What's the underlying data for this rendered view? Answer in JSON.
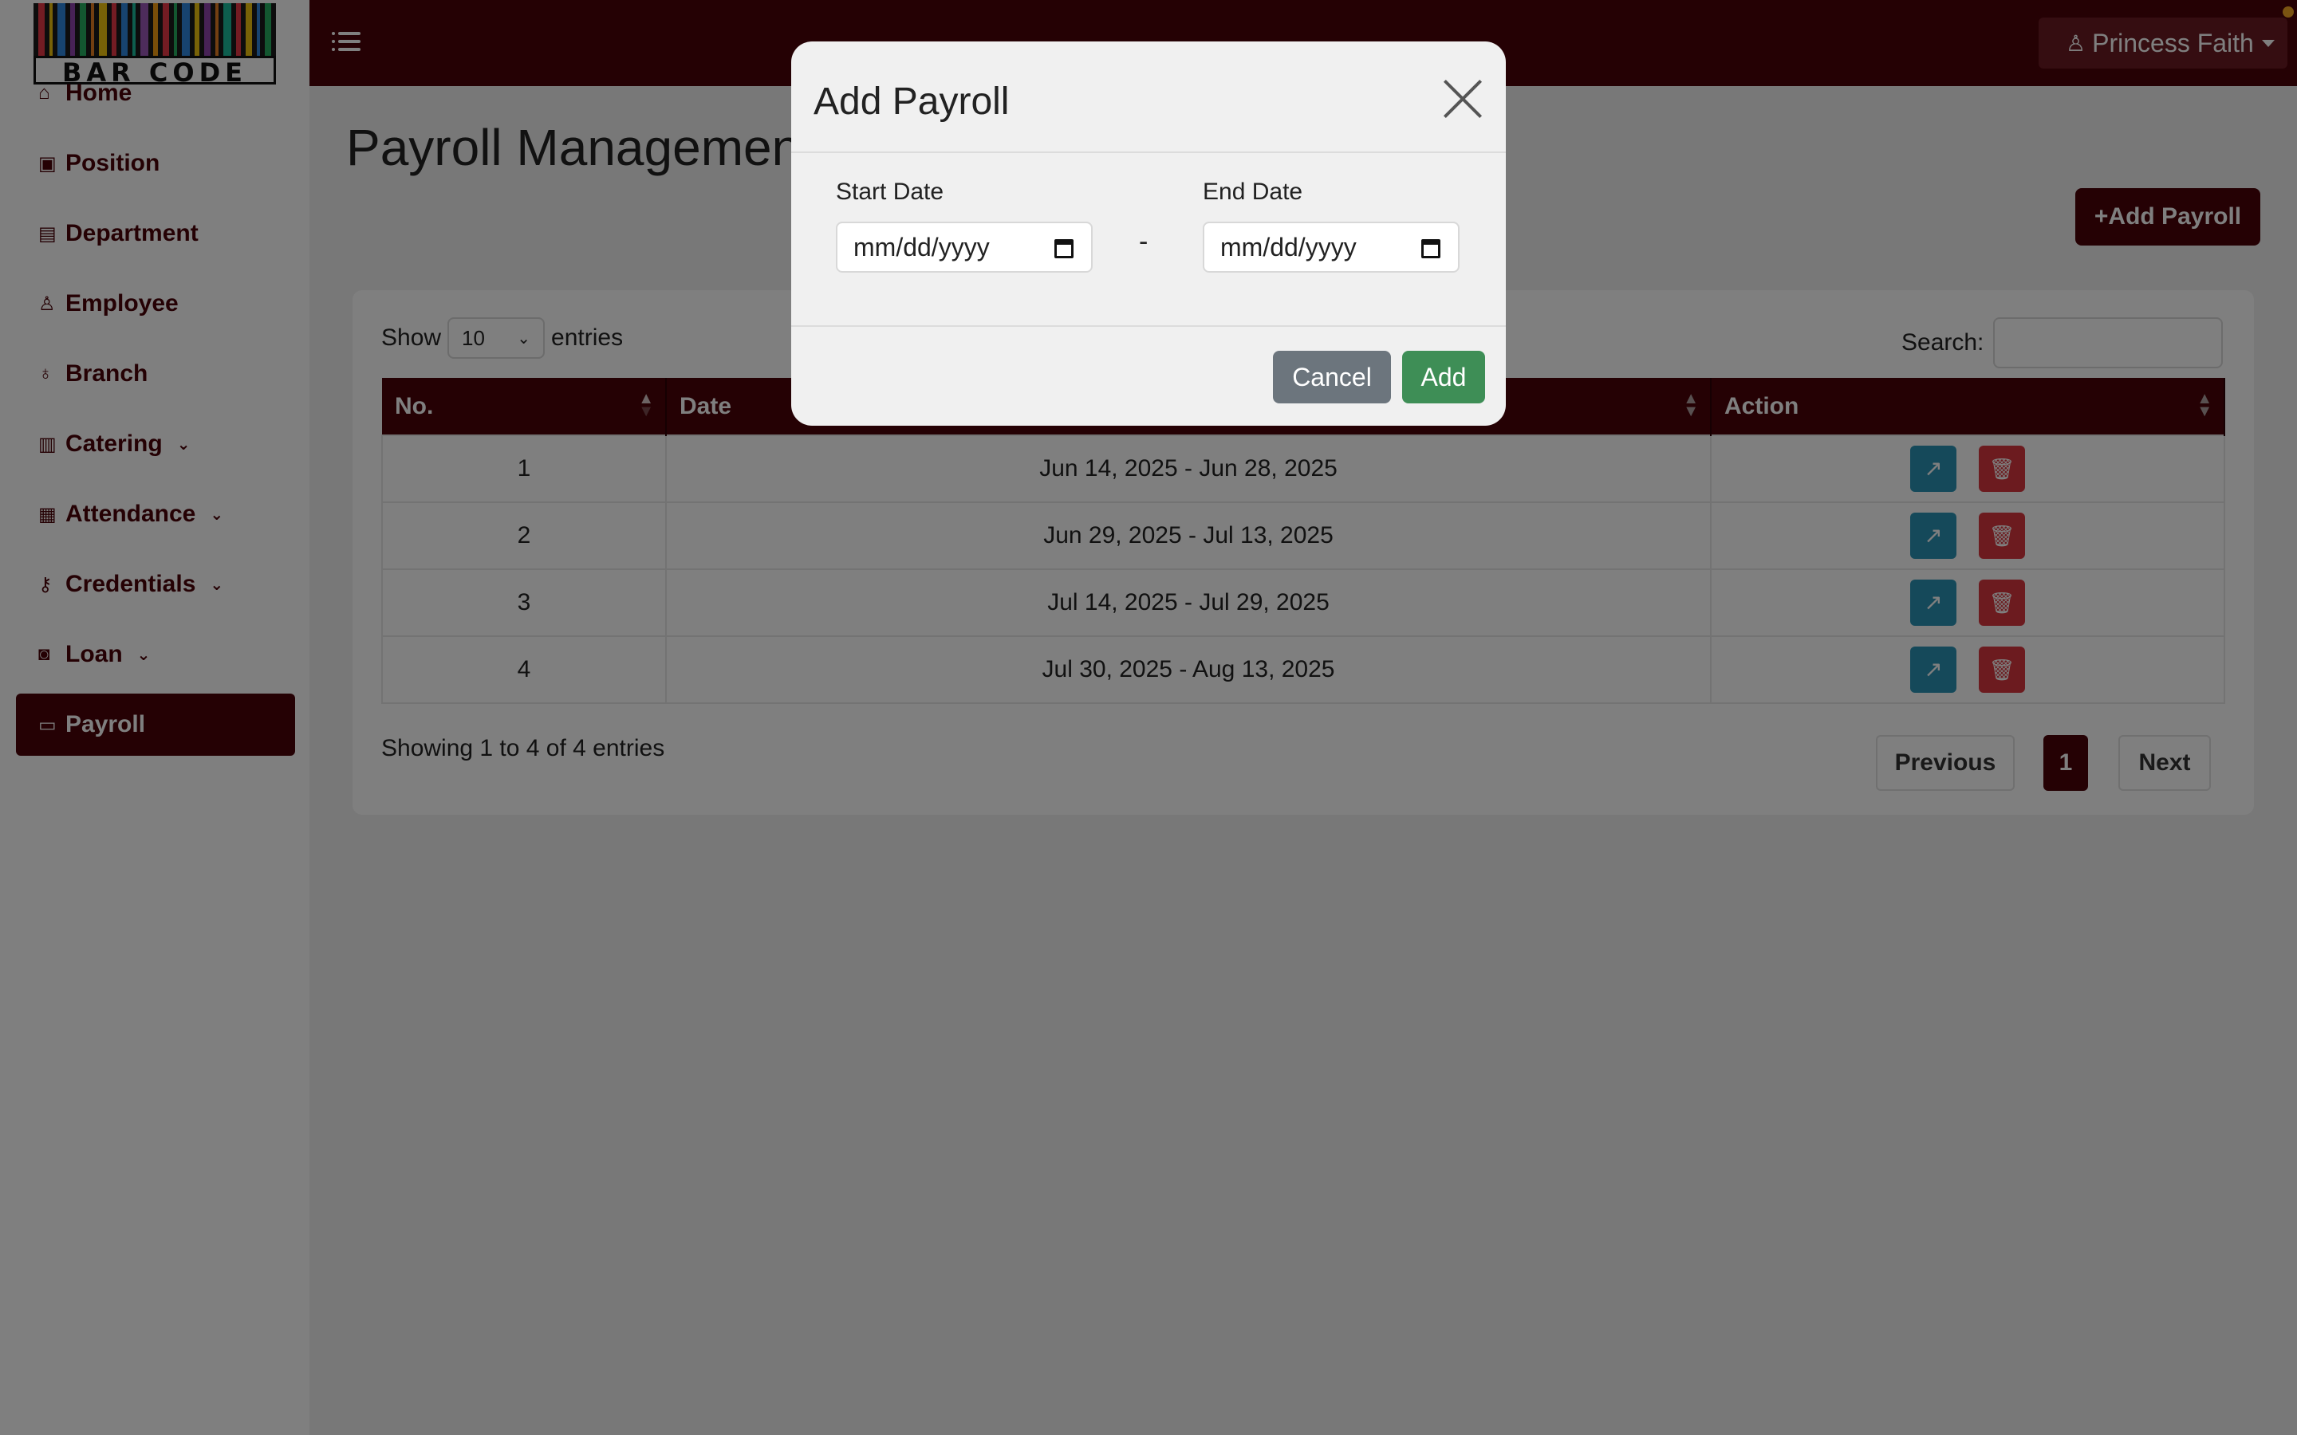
{
  "brand": {
    "logo_text": "BAR CODE"
  },
  "user": {
    "name": "Princess Faith"
  },
  "sidebar": {
    "items": [
      {
        "label": "Home",
        "icon": "home-icon",
        "glyph": "⌂",
        "has_submenu": false,
        "active": false
      },
      {
        "label": "Position",
        "icon": "position-icon",
        "glyph": "▣",
        "has_submenu": false,
        "active": false
      },
      {
        "label": "Department",
        "icon": "building-icon",
        "glyph": "▤",
        "has_submenu": false,
        "active": false
      },
      {
        "label": "Employee",
        "icon": "person-icon",
        "glyph": "♙",
        "has_submenu": false,
        "active": false
      },
      {
        "label": "Branch",
        "icon": "branch-icon",
        "glyph": "♁",
        "has_submenu": false,
        "active": false
      },
      {
        "label": "Catering",
        "icon": "catering-icon",
        "glyph": "▥",
        "has_submenu": true,
        "active": false
      },
      {
        "label": "Attendance",
        "icon": "calendar-icon",
        "glyph": "▦",
        "has_submenu": true,
        "active": false
      },
      {
        "label": "Credentials",
        "icon": "key-icon",
        "glyph": "⚷",
        "has_submenu": true,
        "active": false
      },
      {
        "label": "Loan",
        "icon": "cash-icon",
        "glyph": "◙",
        "has_submenu": true,
        "active": false
      },
      {
        "label": "Payroll",
        "icon": "card-icon",
        "glyph": "▭",
        "has_submenu": false,
        "active": true
      }
    ]
  },
  "main": {
    "title": "Payroll Management",
    "add_button": "+Add Payroll",
    "show_label": "Show",
    "entries_value": "10",
    "entries_label": "entries",
    "search_label": "Search:",
    "search_value": "",
    "table": {
      "columns": [
        "No.",
        "Date",
        "Action"
      ],
      "rows": [
        {
          "no": "1",
          "date": "Jun 14, 2025 - Jun 28, 2025"
        },
        {
          "no": "2",
          "date": "Jun 29, 2025 - Jul 13, 2025"
        },
        {
          "no": "3",
          "date": "Jul 14, 2025 - Jul 29, 2025"
        },
        {
          "no": "4",
          "date": "Jul 30, 2025 - Aug 13, 2025"
        }
      ]
    },
    "showing_text": "Showing 1 to 4 of 4 entries",
    "pagination": {
      "previous": "Previous",
      "current": "1",
      "next": "Next"
    }
  },
  "modal": {
    "title": "Add Payroll",
    "start_label": "Start Date",
    "start_placeholder": "mm/dd/yyyy",
    "end_label": "End Date",
    "end_placeholder": "mm/dd/yyyy",
    "separator": "-",
    "cancel": "Cancel",
    "add": "Add"
  },
  "colors": {
    "brand": "#4a0208",
    "edit": "#2b93b5",
    "delete": "#d9363e",
    "add": "#3e8e56",
    "cancel": "#6c757d"
  }
}
